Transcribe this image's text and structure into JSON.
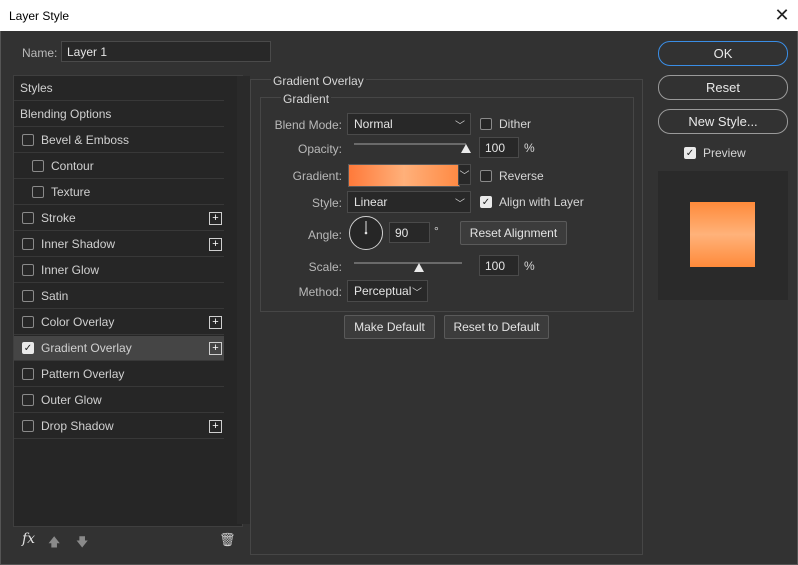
{
  "window": {
    "title": "Layer Style"
  },
  "name_field": {
    "label": "Name:",
    "value": "Layer 1"
  },
  "styles_list": [
    {
      "label": "Styles",
      "checkbox": false,
      "checked": false,
      "indent": 0,
      "plus": false,
      "active": false
    },
    {
      "label": "Blending Options",
      "checkbox": false,
      "checked": false,
      "indent": 0,
      "plus": false,
      "active": false
    },
    {
      "label": "Bevel & Emboss",
      "checkbox": true,
      "checked": false,
      "indent": 0,
      "plus": false,
      "active": false
    },
    {
      "label": "Contour",
      "checkbox": true,
      "checked": false,
      "indent": 1,
      "plus": false,
      "active": false
    },
    {
      "label": "Texture",
      "checkbox": true,
      "checked": false,
      "indent": 1,
      "plus": false,
      "active": false
    },
    {
      "label": "Stroke",
      "checkbox": true,
      "checked": false,
      "indent": 0,
      "plus": true,
      "active": false
    },
    {
      "label": "Inner Shadow",
      "checkbox": true,
      "checked": false,
      "indent": 0,
      "plus": true,
      "active": false
    },
    {
      "label": "Inner Glow",
      "checkbox": true,
      "checked": false,
      "indent": 0,
      "plus": false,
      "active": false
    },
    {
      "label": "Satin",
      "checkbox": true,
      "checked": false,
      "indent": 0,
      "plus": false,
      "active": false
    },
    {
      "label": "Color Overlay",
      "checkbox": true,
      "checked": false,
      "indent": 0,
      "plus": true,
      "active": false
    },
    {
      "label": "Gradient Overlay",
      "checkbox": true,
      "checked": true,
      "indent": 0,
      "plus": true,
      "active": true
    },
    {
      "label": "Pattern Overlay",
      "checkbox": true,
      "checked": false,
      "indent": 0,
      "plus": false,
      "active": false
    },
    {
      "label": "Outer Glow",
      "checkbox": true,
      "checked": false,
      "indent": 0,
      "plus": false,
      "active": false
    },
    {
      "label": "Drop Shadow",
      "checkbox": true,
      "checked": false,
      "indent": 0,
      "plus": true,
      "active": false
    }
  ],
  "bottom_toolbar": {
    "fx": "fx",
    "icons": [
      "fx-icon",
      "move-up-icon",
      "move-down-icon",
      "trash-icon"
    ]
  },
  "panel": {
    "section_title": "Gradient Overlay",
    "group_title": "Gradient",
    "blend_mode": {
      "label": "Blend Mode:",
      "value": "Normal"
    },
    "dither": {
      "label": "Dither",
      "checked": false
    },
    "opacity": {
      "label": "Opacity:",
      "value": "100",
      "unit": "%",
      "level": 1.0
    },
    "gradient": {
      "label": "Gradient:",
      "colors": [
        "#ff7a3a",
        "#ffb07a",
        "#ff8a44"
      ]
    },
    "reverse": {
      "label": "Reverse",
      "checked": false
    },
    "style": {
      "label": "Style:",
      "value": "Linear"
    },
    "align_with_layer": {
      "label": "Align with Layer",
      "checked": true
    },
    "angle": {
      "label": "Angle:",
      "value": "90",
      "unit": "°"
    },
    "reset_alignment": "Reset Alignment",
    "scale": {
      "label": "Scale:",
      "value": "100",
      "unit": "%",
      "level": 0.6
    },
    "method": {
      "label": "Method:",
      "value": "Perceptual"
    },
    "make_default": "Make Default",
    "reset_to_default": "Reset to Default"
  },
  "right_buttons": {
    "ok": "OK",
    "reset": "Reset",
    "new_style": "New Style...",
    "preview": {
      "label": "Preview",
      "checked": true
    }
  },
  "preview_colors": {
    "background": "#2a2a2a",
    "swatch_top": "#ff8a3a",
    "swatch_mid": "#ffb27a",
    "swatch_bottom": "#ff8a3a"
  }
}
